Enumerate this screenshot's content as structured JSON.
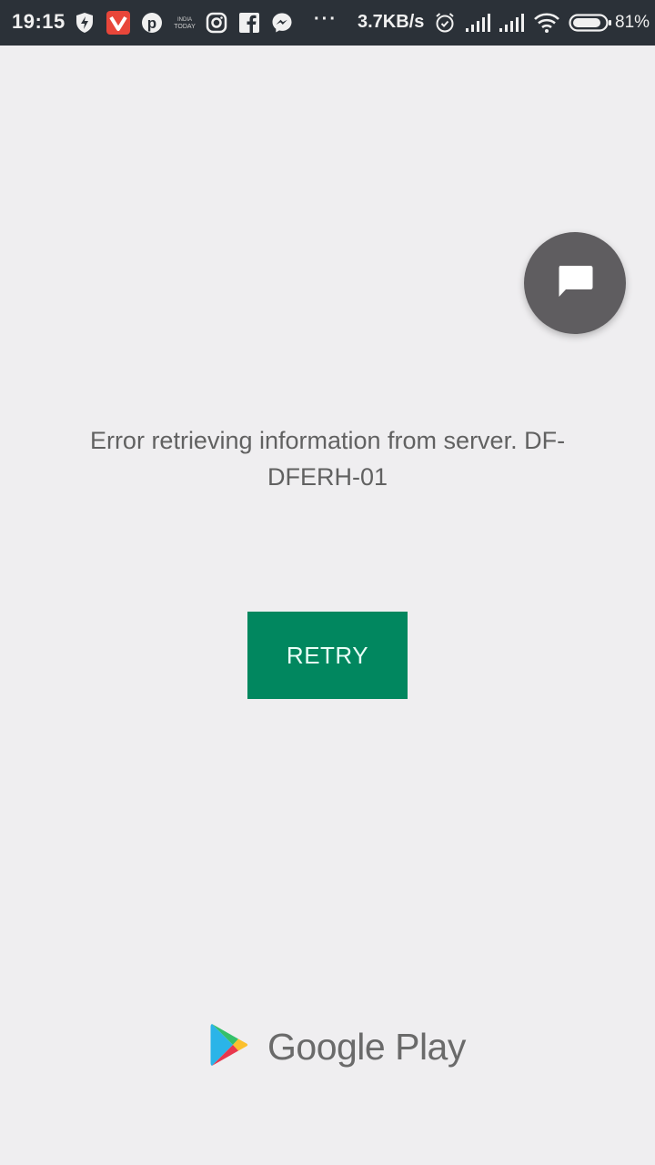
{
  "status_bar": {
    "time": "19:15",
    "notification_icons": [
      "shield-bolt-icon",
      "vivaldi-icon",
      "pinterest-icon",
      "india-today-icon",
      "instagram-icon",
      "facebook-icon",
      "messenger-icon"
    ],
    "more_indicator": "···",
    "network_speed": "3.7KB/s",
    "system_icons": [
      "alarm-icon",
      "signal-sim1-icon",
      "signal-sim2-icon",
      "wifi-icon",
      "battery-icon"
    ],
    "battery_percent": "81%"
  },
  "chat_fab": {
    "icon": "chat-bubble-icon"
  },
  "error": {
    "message": "Error retrieving information from server. DF-DFERH-01"
  },
  "retry_button": {
    "label": "RETRY",
    "color": "#01875f"
  },
  "footer": {
    "brand": "Google Play"
  }
}
